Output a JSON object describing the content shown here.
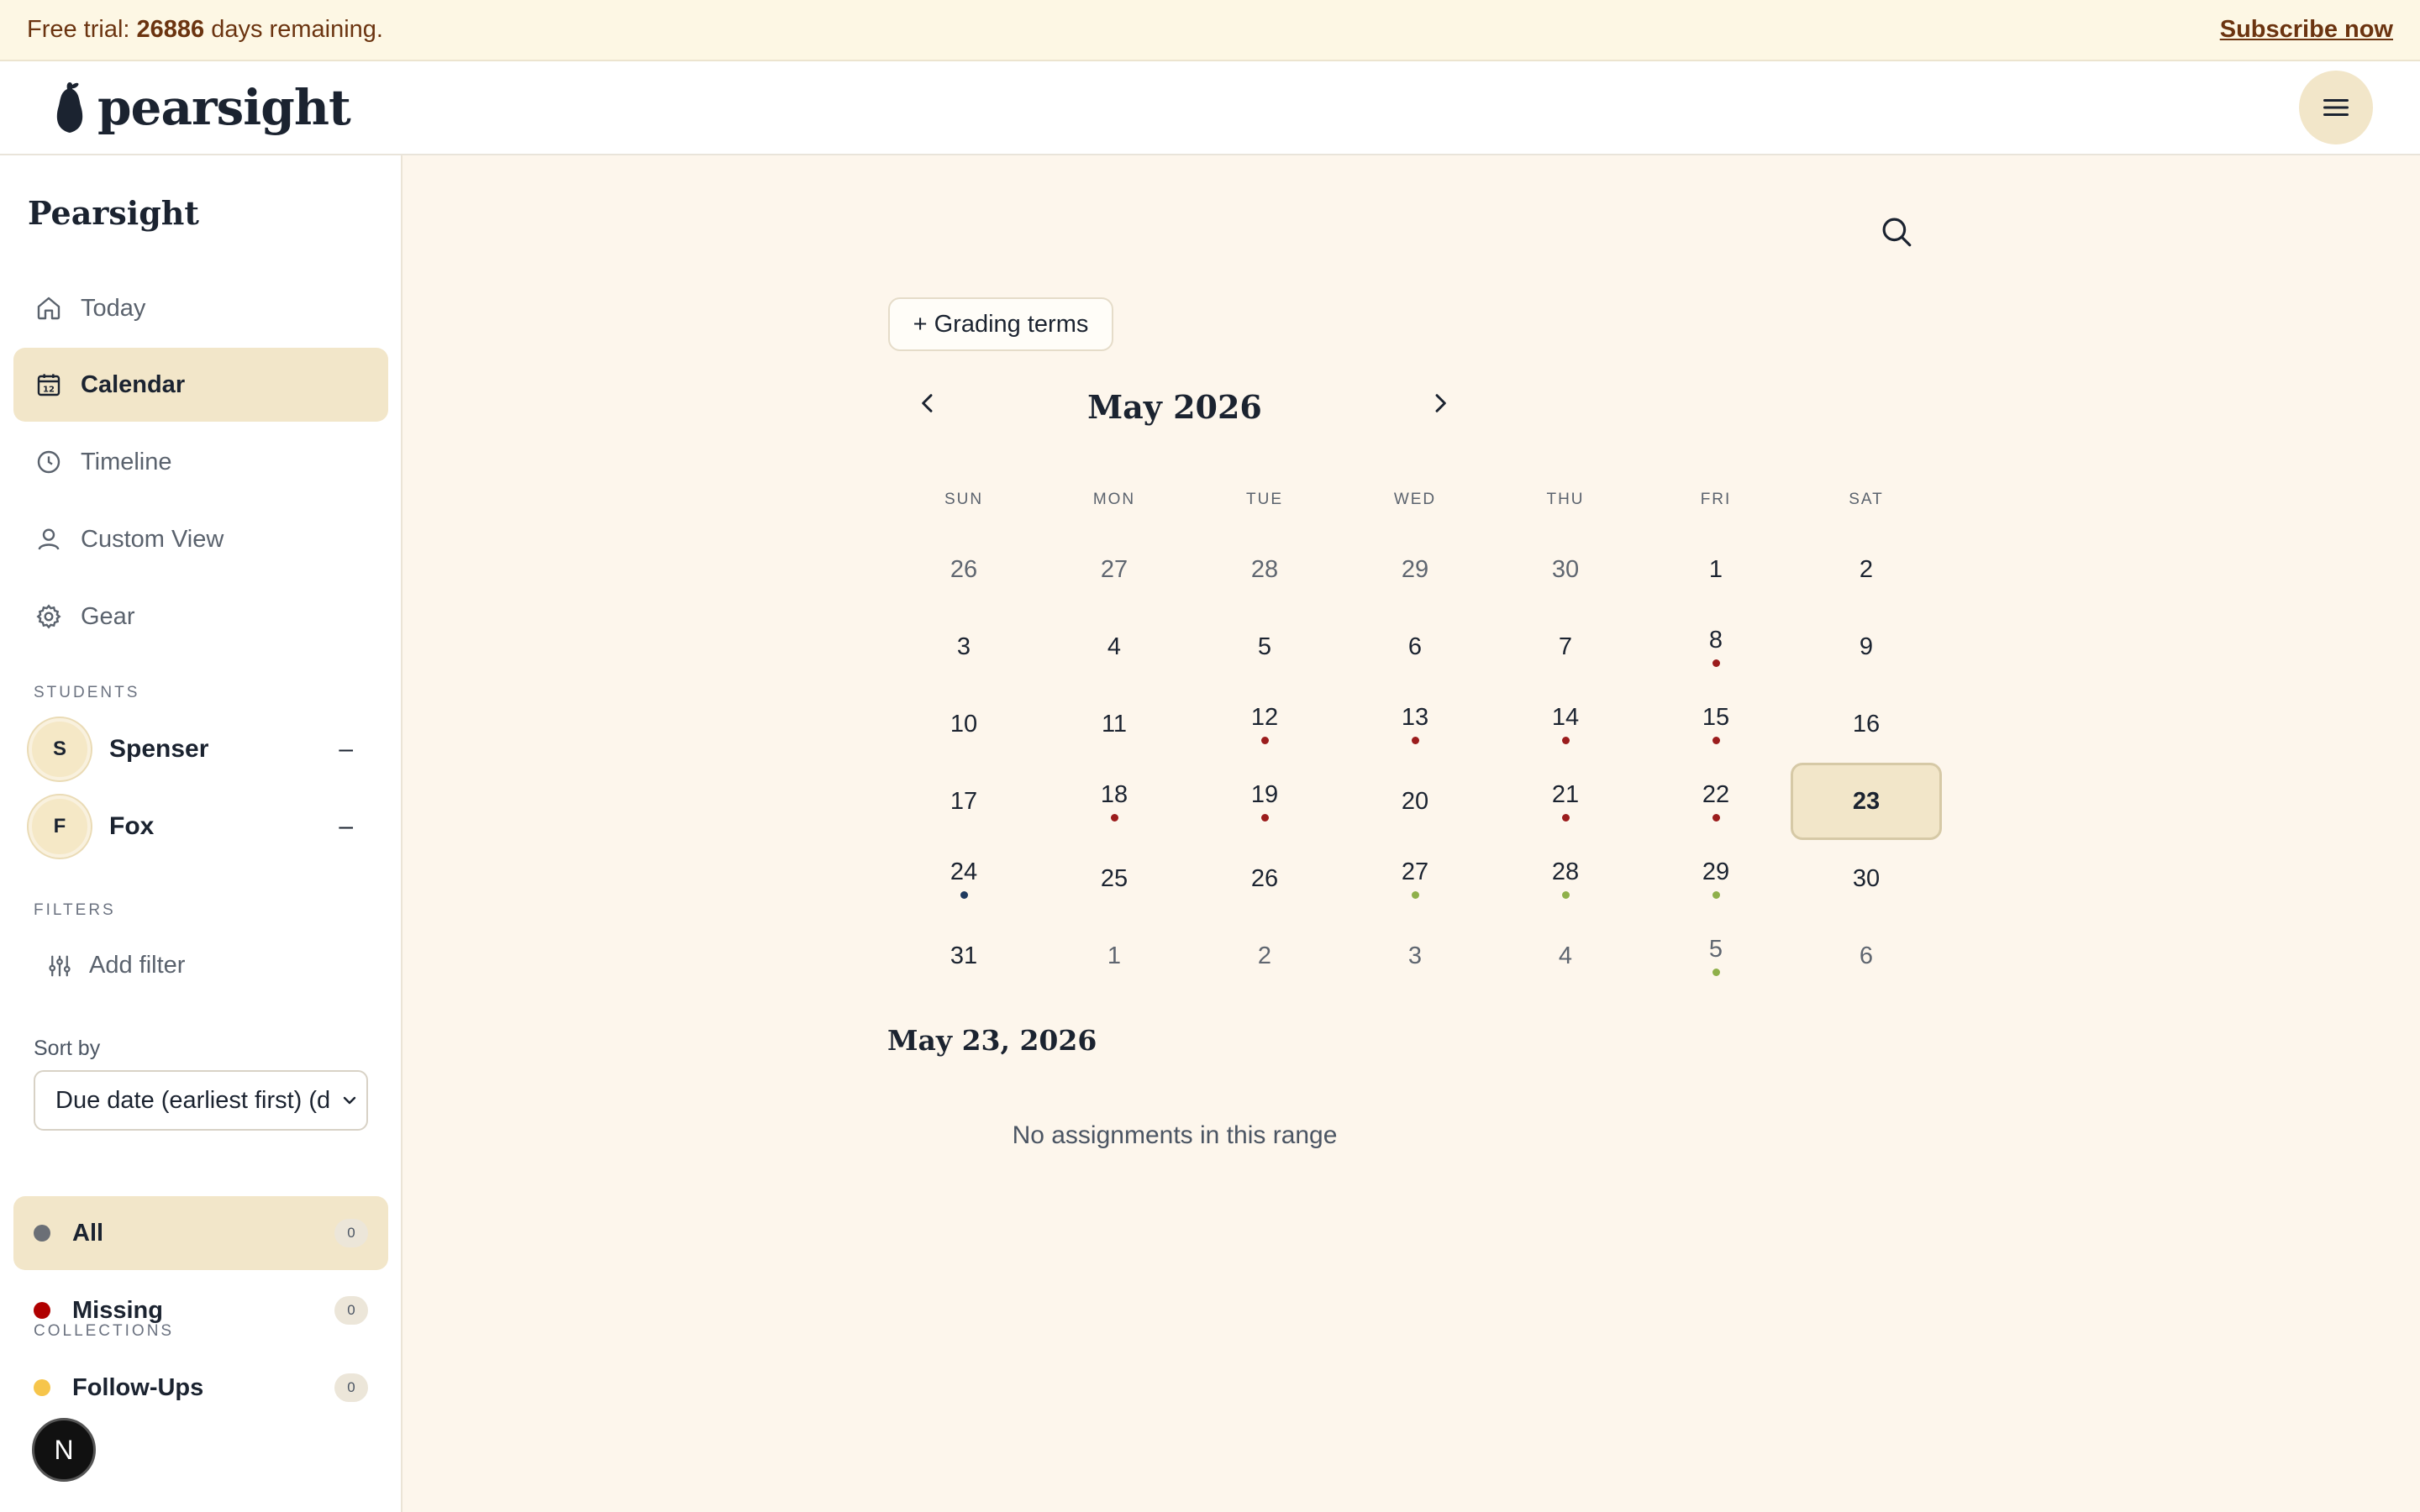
{
  "banner": {
    "prefix": "Free trial: ",
    "days": "26886",
    "suffix": " days remaining.",
    "subscribe": "Subscribe now"
  },
  "header": {
    "logo_text": "pearsight",
    "menu_icon": "menu-icon"
  },
  "sidebar": {
    "title": "Pearsight",
    "nav": [
      {
        "label": "Today",
        "icon": "home-icon"
      },
      {
        "label": "Calendar",
        "icon": "calendar-icon",
        "active": true
      },
      {
        "label": "Timeline",
        "icon": "clock-icon"
      },
      {
        "label": "Custom View",
        "icon": "user-icon"
      },
      {
        "label": "Gear",
        "icon": "gear-icon"
      }
    ],
    "students_label": "STUDENTS",
    "students": [
      {
        "initial": "S",
        "name": "Spenser",
        "toggle": "–"
      },
      {
        "initial": "F",
        "name": "Fox",
        "toggle": "–"
      }
    ],
    "filters_label": "FILTERS",
    "add_filter": "Add filter",
    "sort_label": "Sort by",
    "sort_value": "Due date (earliest first) (d",
    "collections_label": "COLLECTIONS",
    "collections": [
      {
        "label": "All",
        "count": "0",
        "color": "#6b6f76",
        "active": true
      },
      {
        "label": "Missing",
        "count": "0",
        "color": "#b00000"
      },
      {
        "label": "Follow-Ups",
        "count": "0",
        "color": "#f6c54b"
      }
    ],
    "n_badge": "N"
  },
  "main": {
    "grading_button": "+ Grading terms",
    "month_title": "May 2026",
    "weekdays": [
      "SUN",
      "MON",
      "TUE",
      "WED",
      "THU",
      "FRI",
      "SAT"
    ],
    "dot_colors": {
      "red": "#9b1c1c",
      "navy": "#1f3a5f",
      "green": "#8fb04a"
    },
    "weeks": [
      [
        {
          "d": "26",
          "o": true
        },
        {
          "d": "27",
          "o": true
        },
        {
          "d": "28",
          "o": true
        },
        {
          "d": "29",
          "o": true
        },
        {
          "d": "30",
          "o": true
        },
        {
          "d": "1"
        },
        {
          "d": "2"
        }
      ],
      [
        {
          "d": "3"
        },
        {
          "d": "4"
        },
        {
          "d": "5"
        },
        {
          "d": "6"
        },
        {
          "d": "7"
        },
        {
          "d": "8",
          "dot": "red"
        },
        {
          "d": "9"
        }
      ],
      [
        {
          "d": "10"
        },
        {
          "d": "11"
        },
        {
          "d": "12",
          "dot": "red"
        },
        {
          "d": "13",
          "dot": "red"
        },
        {
          "d": "14",
          "dot": "red"
        },
        {
          "d": "15",
          "dot": "red"
        },
        {
          "d": "16"
        }
      ],
      [
        {
          "d": "17"
        },
        {
          "d": "18",
          "dot": "red"
        },
        {
          "d": "19",
          "dot": "red"
        },
        {
          "d": "20"
        },
        {
          "d": "21",
          "dot": "red"
        },
        {
          "d": "22",
          "dot": "red"
        },
        {
          "d": "23",
          "selected": true
        }
      ],
      [
        {
          "d": "24",
          "dot": "navy"
        },
        {
          "d": "25"
        },
        {
          "d": "26"
        },
        {
          "d": "27",
          "dot": "green"
        },
        {
          "d": "28",
          "dot": "green"
        },
        {
          "d": "29",
          "dot": "green"
        },
        {
          "d": "30"
        }
      ],
      [
        {
          "d": "31"
        },
        {
          "d": "1",
          "o": true
        },
        {
          "d": "2",
          "o": true
        },
        {
          "d": "3",
          "o": true
        },
        {
          "d": "4",
          "o": true
        },
        {
          "d": "5",
          "o": true,
          "dot": "green"
        },
        {
          "d": "6",
          "o": true
        }
      ]
    ],
    "selected_date": "May 23, 2026",
    "empty_message": "No assignments in this range"
  }
}
